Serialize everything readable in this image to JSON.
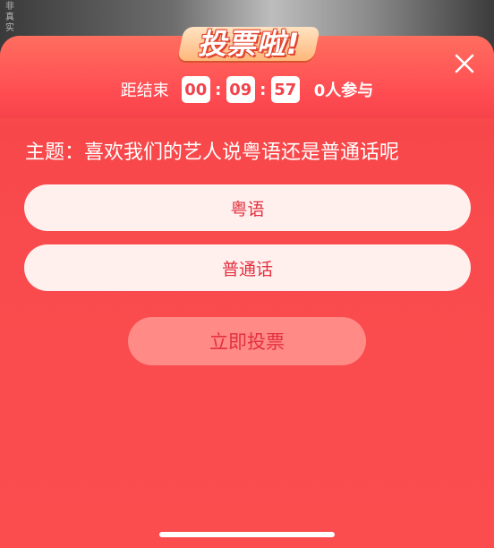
{
  "background": {
    "side_text": "非真实"
  },
  "header": {
    "title": "投票啦!",
    "countdown_label": "距结束",
    "countdown": {
      "hours": "00",
      "minutes": "09",
      "seconds": "57"
    },
    "colon": ":",
    "participants": "0人参与"
  },
  "topic": "主题：喜欢我们的艺人说粤语还是普通话呢",
  "options": [
    {
      "label": "粤语"
    },
    {
      "label": "普通话"
    }
  ],
  "vote_button_label": "立即投票",
  "colors": {
    "panel_red": "#f94a4d",
    "option_bg": "#fff0ee",
    "accent_text": "#e3303f",
    "vote_button_bg": "#ff8a86"
  },
  "icons": {
    "close": "close-icon"
  }
}
